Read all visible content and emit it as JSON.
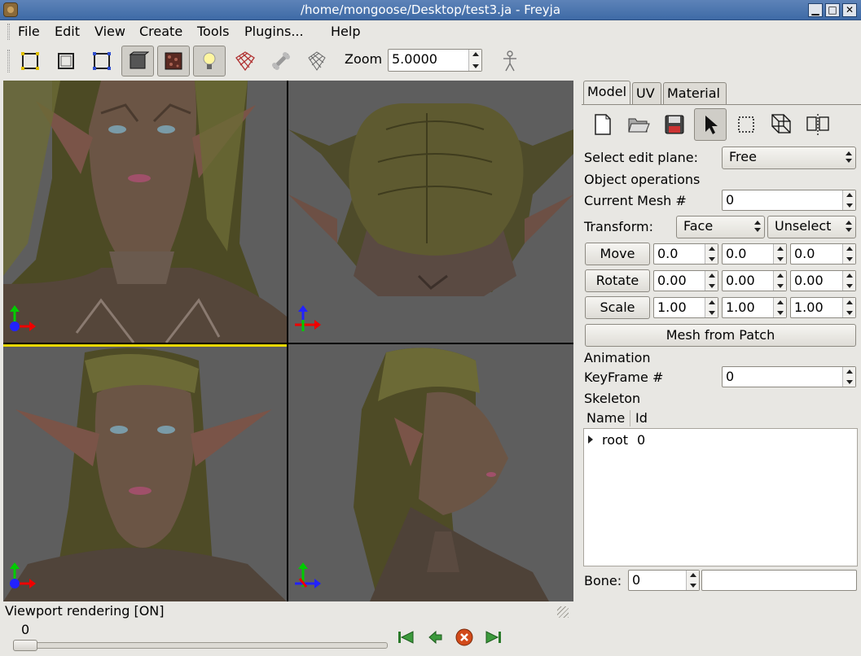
{
  "window": {
    "title": "/home/mongoose/Desktop/test3.ja - Freyja",
    "buttons": {
      "minimize": "▁",
      "maximize": "□",
      "close": "✕"
    }
  },
  "menu": [
    "File",
    "Edit",
    "View",
    "Create",
    "Tools",
    "Plugins...",
    "Help"
  ],
  "toolbar": {
    "zoom_label": "Zoom",
    "zoom_value": "5.0000",
    "tools": [
      "select-vertex-icon",
      "box-icon",
      "box-select-icon",
      "solid-view-icon",
      "texture-view-icon",
      "light-icon",
      "wireframe-mesh-icon",
      "bone-icon",
      "grid-icon",
      "skeleton-figure-icon"
    ]
  },
  "viewports": {
    "status": "Viewport rendering [ON]"
  },
  "timeline": {
    "frame": "0"
  },
  "panel": {
    "tabs": [
      "Model",
      "UV",
      "Material"
    ],
    "active_tab": "Model",
    "select_edit_plane_label": "Select edit plane:",
    "edit_plane_value": "Free",
    "object_operations_label": "Object operations",
    "current_mesh_label": "Current Mesh  #",
    "current_mesh_value": "0",
    "transform_label": "Transform:",
    "transform_target": "Face",
    "transform_action": "Unselect",
    "move": {
      "label": "Move",
      "values": [
        "0.0",
        "0.0",
        "0.0"
      ]
    },
    "rotate": {
      "label": "Rotate",
      "values": [
        "0.00",
        "0.00",
        "0.00"
      ]
    },
    "scale": {
      "label": "Scale",
      "values": [
        "1.00",
        "1.00",
        "1.00"
      ]
    },
    "mesh_from_patch": "Mesh from Patch",
    "animation_label": "Animation",
    "keyframe_label": "KeyFrame #",
    "keyframe_value": "0",
    "skeleton_label": "Skeleton",
    "tree_columns": [
      "Name",
      "Id"
    ],
    "tree_rows": [
      {
        "name": "root",
        "id": "0"
      }
    ],
    "bone_label": "Bone:",
    "bone_value": "0",
    "bone_name": ""
  }
}
